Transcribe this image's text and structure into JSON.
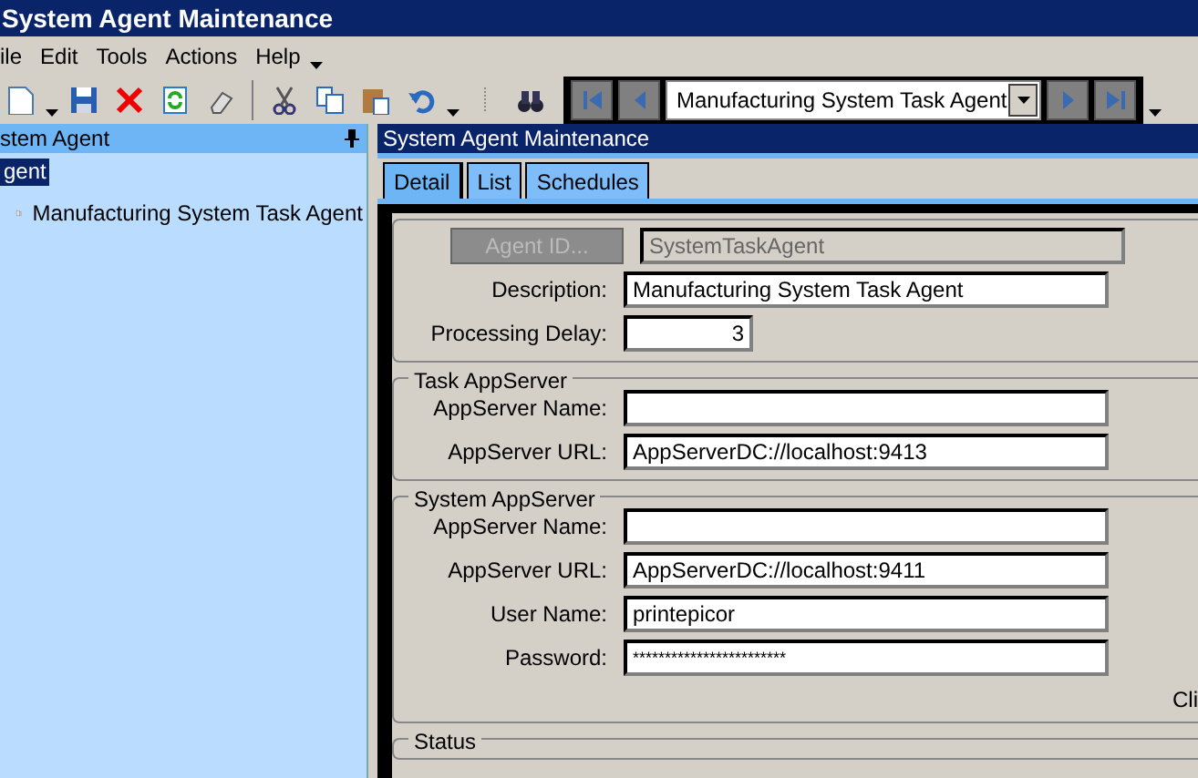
{
  "window": {
    "title": "System Agent Maintenance"
  },
  "menu": [
    "ile",
    "Edit",
    "Tools",
    "Actions",
    "Help"
  ],
  "navigator": {
    "value": "Manufacturing System Task Agent"
  },
  "tree_panel": {
    "title": "stem Agent",
    "items": [
      {
        "label": "gent",
        "selected": true,
        "children": [
          {
            "label": "Manufacturing System Task Agent",
            "selected": false
          }
        ]
      }
    ]
  },
  "main_panel": {
    "title": "System Agent Maintenance",
    "tabs": [
      {
        "label": "Detail",
        "selected": true
      },
      {
        "label": "List",
        "selected": false
      },
      {
        "label": "Schedules",
        "selected": false
      }
    ]
  },
  "sections": [
    {
      "rows": [
        {
          "kind": "button",
          "label": "Agent ID...",
          "value": "SystemTaskAgent",
          "disabled": true
        },
        {
          "kind": "text",
          "label": "Description:",
          "value": "Manufacturing System Task Agent"
        },
        {
          "kind": "number",
          "label": "Processing Delay:",
          "value": "3"
        }
      ]
    },
    {
      "title": "Task AppServer",
      "rows": [
        {
          "kind": "text",
          "label": "AppServer Name:"
        },
        {
          "kind": "text",
          "label": "AppServer URL:",
          "value": "AppServerDC://localhost:9413"
        }
      ]
    },
    {
      "title": "System AppServer",
      "rows": [
        {
          "kind": "text",
          "label": "AppServer Name:"
        },
        {
          "kind": "text",
          "label": "AppServer URL:",
          "value": "AppServerDC://localhost:9411"
        },
        {
          "kind": "text",
          "label": "User Name:",
          "value": "printepicor"
        },
        {
          "kind": "password",
          "label": "Password:",
          "value": "************************"
        }
      ],
      "note": "Cli"
    },
    {
      "title": "Status"
    }
  ]
}
